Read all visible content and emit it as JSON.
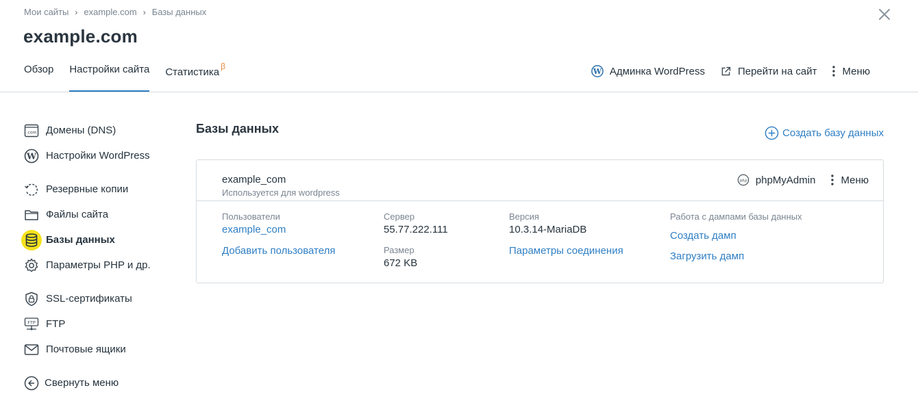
{
  "breadcrumb": [
    "Мои сайты",
    "example.com",
    "Базы данных"
  ],
  "breadcrumb_separator": "›",
  "site": {
    "title": "example.com"
  },
  "tabs": [
    {
      "label": "Обзор",
      "active": false
    },
    {
      "label": "Настройки сайта",
      "active": true
    },
    {
      "label": "Статистика",
      "badge": "β",
      "active": false
    }
  ],
  "header_actions": {
    "wp_admin": "Админка WordPress",
    "go_to_site": "Перейти на сайт",
    "menu": "Меню"
  },
  "sidebar": {
    "items": [
      {
        "label": "Домены (DNS)",
        "icon": "domain-com-icon"
      },
      {
        "label": "Настройки WordPress",
        "icon": "wordpress-icon"
      },
      {
        "label": "Резервные копии",
        "icon": "backup-icon"
      },
      {
        "label": "Файлы сайта",
        "icon": "folder-icon"
      },
      {
        "label": "Базы данных",
        "icon": "database-icon",
        "active": true
      },
      {
        "label": "Параметры PHP и др.",
        "icon": "gear-icon"
      },
      {
        "label": "SSL-сертификаты",
        "icon": "shield-lock-icon"
      },
      {
        "label": "FTP",
        "icon": "ftp-icon",
        "icon_text": "FTP"
      },
      {
        "label": "Почтовые ящики",
        "icon": "mail-icon"
      }
    ],
    "collapse_label": "Свернуть меню",
    "domain_icon_text": ".com"
  },
  "content": {
    "title": "Базы данных",
    "create_button": "Создать базу данных"
  },
  "db_card": {
    "name": "example_com",
    "subtitle": "Используется для wordpress",
    "phpmyadmin": "phpMyAdmin",
    "menu": "Меню",
    "users_label": "Пользователи",
    "user_value": "example_com",
    "add_user": "Добавить пользователя",
    "server_label": "Сервер",
    "server_value": "55.77.222.111",
    "size_label": "Размер",
    "size_value": "672 KB",
    "version_label": "Версия",
    "version_value": "10.3.14-MariaDB",
    "connection_params": "Параметры соединения",
    "dumps_label": "Работа с дампами базы данных",
    "create_dump": "Создать дамп",
    "upload_dump": "Загрузить дамп",
    "php_icon_text": "php"
  },
  "colors": {
    "accent": "#2f7fc4",
    "text": "#26333d",
    "muted": "#7a8591",
    "beta": "#e8883a",
    "highlight": "#f5e11c",
    "border": "#d6dbe0"
  }
}
